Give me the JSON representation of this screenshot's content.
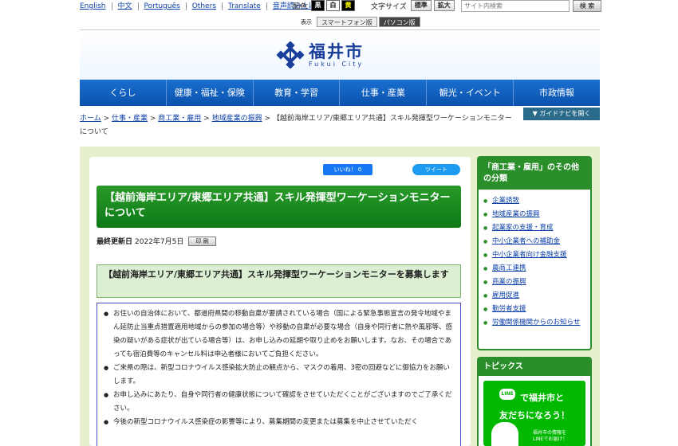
{
  "topbar": {
    "languages": [
      "English",
      "中文",
      "Português",
      "Others",
      "Translate",
      "音声読み上げ"
    ],
    "color_label": "配色",
    "color_options": [
      "黒",
      "白",
      "黄"
    ],
    "fontsize_label": "文字サイズ",
    "fontsize_options": [
      "標準",
      "拡大"
    ],
    "search_placeholder": "サイト内検索",
    "search_button": "検 索",
    "display_label": "表示",
    "display_sp": "スマートフォン版",
    "display_pc": "パソコン版"
  },
  "header": {
    "logo_jp": "福井市",
    "logo_en": "Fukui City"
  },
  "gnav": [
    "くらし",
    "健康・福祉・保険",
    "教育・学習",
    "仕事・産業",
    "観光・イベント",
    "市政情報"
  ],
  "guide_button": "▼ ガイドナビを開く",
  "breadcrumb": {
    "items": [
      "ホーム",
      "仕事・産業",
      "商工業・雇用",
      "地域産業の振興"
    ],
    "current": "【越前海岸エリア/東郷エリア共通】スキル発揮型ワーケーションモニターについて"
  },
  "social": {
    "like": "いいね！ 0",
    "tweet": "ツイート"
  },
  "article": {
    "title": "【越前海岸エリア/東郷エリア共通】スキル発揮型ワーケーションモニターについて",
    "updated_label": "最終更新日",
    "updated_date": "2022年7月5日",
    "print_label": "印 刷",
    "h2": "【越前海岸エリア/東郷エリア共通】スキル発揮型ワーケーションモニターを募集します",
    "notices": [
      "お住いの自治体において、都道府県間の移動自粛が要請されている場合（国による緊急事態宣言の発令地域やまん延防止当重点措置適用地域からの参加の場合等）や移動の自粛が必要な場合（自身や同行者に熱や風邪等、感染の疑いがある症状が出ている場合等）は、お申し込みの延期や取り止めをお願いします。なお、その場合であっても宿泊費等のキャンセル料は申込者様においてご負担ください。",
      "ご来県の際は、新型コロナウイルス感染拡大防止の観点から、マスクの着用、3密の回避などに御協力をお願いします。",
      "お申し込みにあたり、自身や同行者の健康状態について確認をさせていただくことがございますのでご了承ください。",
      "今後の新型コロナウイルス感染症の影響等により、募集期間の変更または募集を中止させていただく"
    ]
  },
  "sidebar": {
    "heading": "「商工業・雇用」のその他の分類",
    "items": [
      "企業誘致",
      "地域産業の振興",
      "起業家の支援・育成",
      "中小企業者への補助金",
      "中小企業者向け金融支援",
      "農商工連携",
      "商業の振興",
      "雇用促進",
      "勤労者支援",
      "労働関係機関からのお知らせ"
    ]
  },
  "topics": {
    "heading": "トピックス",
    "line_logo": "LINE",
    "line1": "で福井市と",
    "line2": "友だちになろう！",
    "line3": "福井市の情報を\nLINEでお届け！"
  }
}
